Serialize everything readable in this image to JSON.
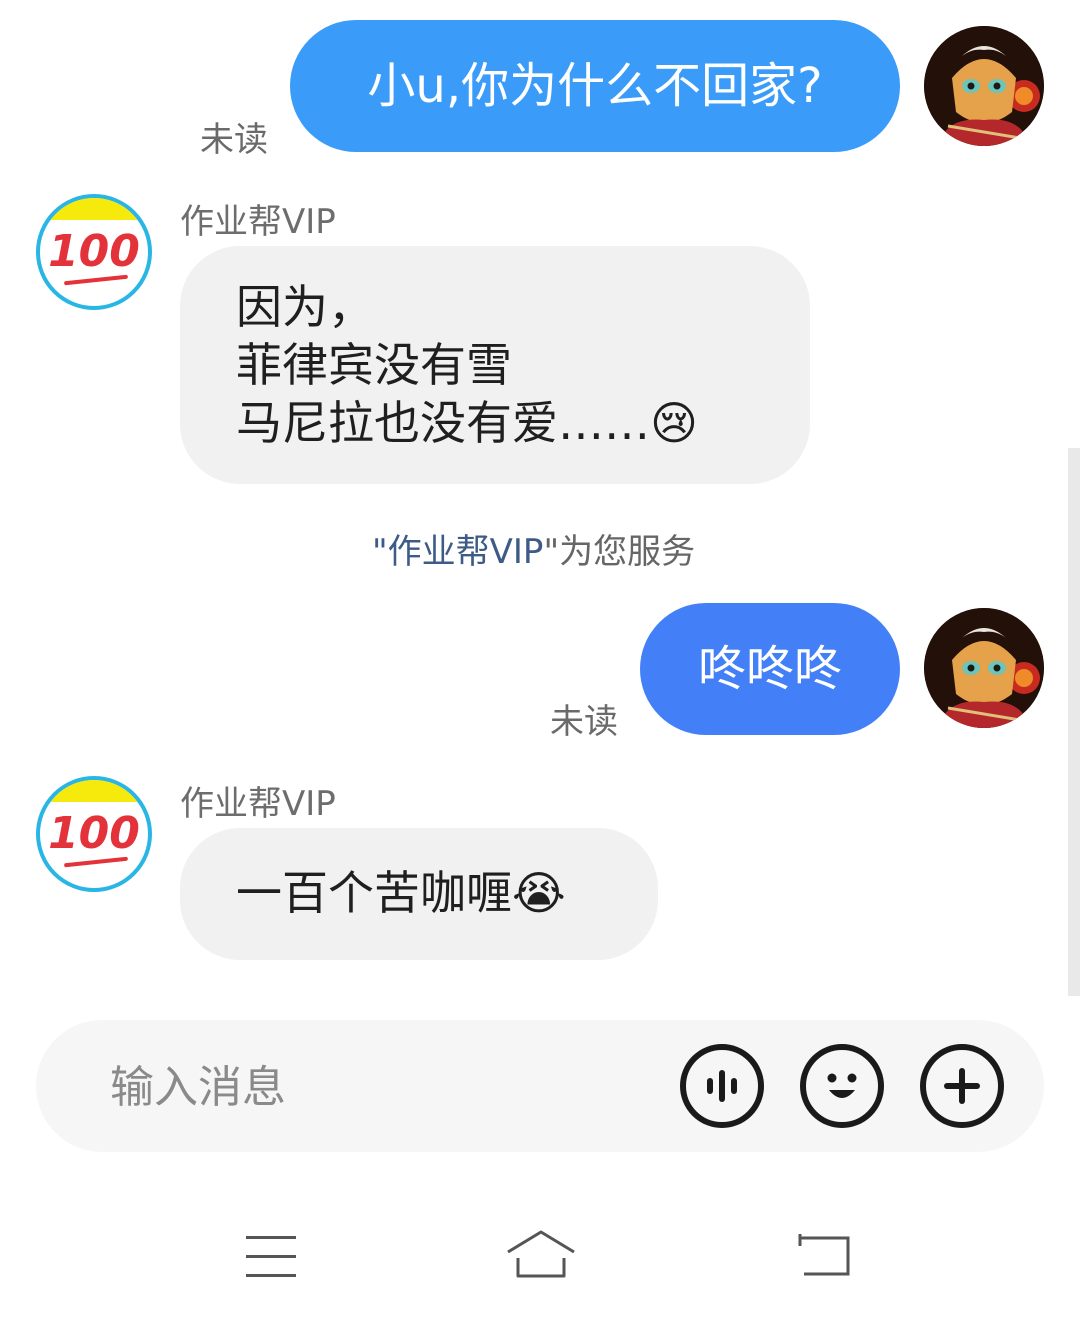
{
  "messages": {
    "m1": {
      "text": "小u,你为什么不回家?",
      "status": "未读"
    },
    "m2": {
      "sender": "作业帮VIP",
      "lines": [
        "因为，",
        "菲律宾没有雪",
        "马尼拉也没有爱……"
      ],
      "emoji": "😢"
    },
    "service_note": {
      "prefix": "\"",
      "vip": "作业帮VIP",
      "suffix": "\"为您服务"
    },
    "m3": {
      "text": "咚咚咚",
      "status": "未读"
    },
    "m4": {
      "sender": "作业帮VIP",
      "text": "一百个苦咖喱",
      "emoji": "😭"
    }
  },
  "bot_avatar": {
    "text": "100"
  },
  "composer": {
    "placeholder": "输入消息"
  },
  "icons": {
    "voice": "voice-icon",
    "emoji": "emoji-icon",
    "plus": "plus-icon",
    "menu": "menu-icon",
    "home": "home-icon",
    "back": "back-icon"
  },
  "colors": {
    "sent_bubble_1": "#3a9cf8",
    "sent_bubble_2": "#4380f7",
    "received_bubble": "#f1f1f1",
    "bot_ring": "#2ab6e4",
    "bot_band": "#f6e90c",
    "bot_digits": "#e3323a"
  }
}
